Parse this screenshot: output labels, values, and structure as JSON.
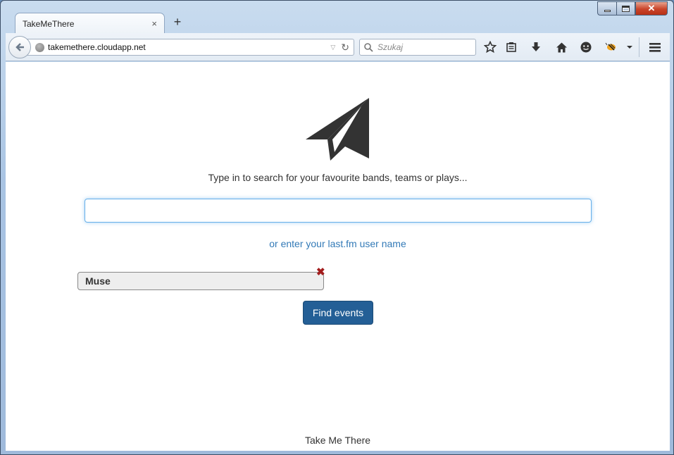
{
  "window": {
    "close_glyph": "✕"
  },
  "tab": {
    "title": "TakeMeThere",
    "close_glyph": "×"
  },
  "toolbar": {
    "new_tab_glyph": "+",
    "url": "takemethere.cloudapp.net",
    "search_placeholder": "Szukaj"
  },
  "page": {
    "tagline": "Type in to search for your favourite bands, teams or plays...",
    "search_value": "",
    "lastfm_link": "or enter your last.fm user name",
    "selected_chip": "Muse",
    "remove_glyph": "✖",
    "find_button": "Find events",
    "footer": "Take Me There"
  },
  "colors": {
    "accent": "#245f96",
    "link": "#337ab7",
    "remove": "#a21c1c",
    "focus": "#66afe9"
  }
}
